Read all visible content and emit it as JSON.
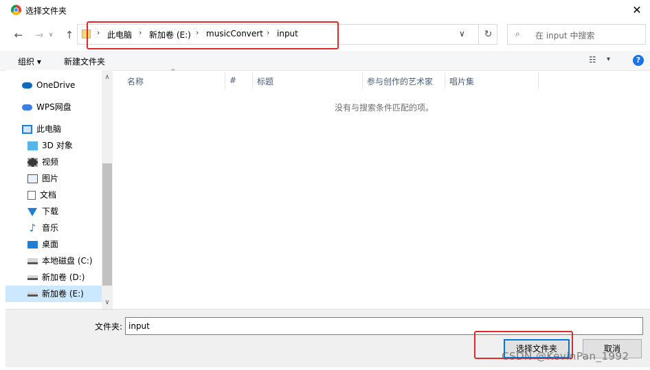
{
  "window": {
    "title": "选择文件夹",
    "close_glyph": "✕"
  },
  "nav": {
    "back_icon": "←",
    "forward_icon": "→",
    "dropdown_icon": "∨",
    "up_icon": "↑",
    "breadcrumbs": [
      "此电脑",
      "新加卷 (E:)",
      "musicConvert",
      "input"
    ],
    "separator": "›",
    "addr_dropdown": "∨",
    "refresh_icon": "↻",
    "search_placeholder": "在 input 中搜索",
    "search_icon": "⌕"
  },
  "toolbar": {
    "organize": "组织 ▾",
    "new_folder": "新建文件夹",
    "view_icon": "☷",
    "view_dropdown": "▾",
    "help": "?"
  },
  "sidebar": {
    "items": [
      {
        "label": "OneDrive",
        "icon": "cloud-icon"
      },
      {
        "label": "WPS网盘",
        "icon": "cloud-icon"
      },
      {
        "label": "此电脑",
        "icon": "computer-icon"
      },
      {
        "label": "3D 对象",
        "icon": "cube-icon"
      },
      {
        "label": "视频",
        "icon": "film-icon"
      },
      {
        "label": "图片",
        "icon": "picture-icon"
      },
      {
        "label": "文档",
        "icon": "document-icon"
      },
      {
        "label": "下载",
        "icon": "download-icon"
      },
      {
        "label": "音乐",
        "icon": "music-icon"
      },
      {
        "label": "桌面",
        "icon": "desktop-icon"
      },
      {
        "label": "本地磁盘 (C:)",
        "icon": "drive-icon"
      },
      {
        "label": "新加卷 (D:)",
        "icon": "drive-icon"
      },
      {
        "label": "新加卷 (E:)",
        "icon": "drive-icon",
        "selected": true
      }
    ],
    "scroll_up": "∧",
    "scroll_down": "∨"
  },
  "columns": [
    "名称",
    "#",
    "标题",
    "参与创作的艺术家",
    "唱片集"
  ],
  "sort_caret": "^",
  "empty_message": "没有与搜索条件匹配的项。",
  "footer": {
    "folder_label": "文件夹:",
    "folder_value": "input",
    "select_button": "选择文件夹",
    "cancel_button": "取消"
  },
  "watermark": "CSDN @KevinPan_1992",
  "colors": {
    "highlight": "#e0272a",
    "selection": "#cce8ff",
    "accent": "#0078d7"
  }
}
